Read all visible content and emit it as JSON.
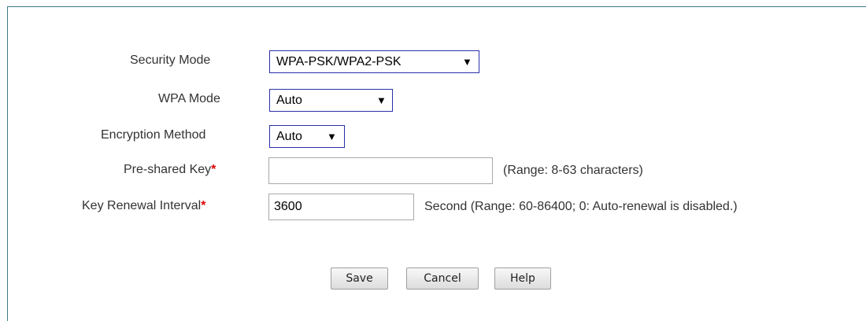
{
  "form": {
    "security_mode": {
      "label": "Security Mode",
      "value": "WPA-PSK/WPA2-PSK",
      "arrow": "▼"
    },
    "wpa_mode": {
      "label": "WPA Mode",
      "value": "Auto",
      "arrow": "▼"
    },
    "encryption_method": {
      "label": "Encryption Method",
      "value": "Auto",
      "arrow": "▼"
    },
    "pre_shared_key": {
      "label": "Pre-shared Key",
      "required_mark": "*",
      "value": "",
      "hint": "(Range: 8-63 characters)"
    },
    "key_renewal_interval": {
      "label": "Key Renewal Interval",
      "required_mark": "*",
      "value": "3600",
      "hint": "Second (Range: 60-86400; 0: Auto-renewal is disabled.)"
    }
  },
  "buttons": {
    "save": "Save",
    "cancel": "Cancel",
    "help": "Help"
  },
  "colors": {
    "frame_border": "#3d7a88",
    "select_border": "#2a2fa8",
    "required": "#e10000"
  }
}
